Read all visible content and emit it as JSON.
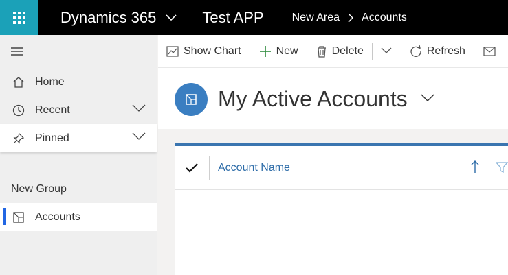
{
  "topbar": {
    "suite_name": "Dynamics 365",
    "app_name": "Test APP",
    "breadcrumb": [
      "New Area",
      "Accounts"
    ],
    "waffle_color": "#1ba1b8"
  },
  "sidebar": {
    "items": [
      {
        "label": "Home",
        "icon": "home-icon"
      },
      {
        "label": "Recent",
        "icon": "clock-icon",
        "expandable": true
      },
      {
        "label": "Pinned",
        "icon": "pin-icon",
        "expandable": true
      }
    ],
    "group": {
      "label": "New Group",
      "items": [
        {
          "label": "Accounts",
          "icon": "accounts-icon",
          "active": true
        }
      ]
    },
    "active_color": "#2266e3"
  },
  "commandbar": {
    "show_chart": "Show Chart",
    "new": "New",
    "delete": "Delete",
    "refresh": "Refresh"
  },
  "view": {
    "title": "My Active Accounts",
    "icon": "accounts-entity-icon",
    "icon_color": "#3a7ec1"
  },
  "grid": {
    "columns": [
      "Account Name"
    ],
    "rows": [],
    "accent_color": "#3a75b0"
  }
}
